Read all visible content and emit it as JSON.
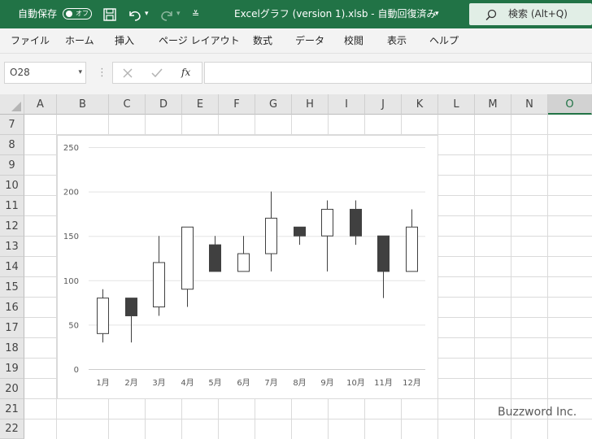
{
  "titlebar": {
    "autosave_label": "自動保存",
    "autosave_state": "オフ",
    "file_title": "Excelグラフ (version 1).xlsb - 自動回復済み",
    "search_label": "検索 (Alt+Q)"
  },
  "menu": [
    "ファイル",
    "ホーム",
    "挿入",
    "ページ レイアウト",
    "数式",
    "データ",
    "校閲",
    "表示",
    "ヘルプ"
  ],
  "namebox": {
    "value": "O28"
  },
  "formula": {
    "value": ""
  },
  "columns": [
    "A",
    "B",
    "C",
    "D",
    "E",
    "F",
    "G",
    "H",
    "I",
    "J",
    "K",
    "L",
    "M",
    "N",
    "O"
  ],
  "rows": [
    "7",
    "8",
    "9",
    "10",
    "11",
    "12",
    "13",
    "14",
    "15",
    "16",
    "17",
    "18",
    "19",
    "20",
    "21",
    "22"
  ],
  "selected_column": "O",
  "chart_data": {
    "type": "candlestick",
    "categories": [
      "1月",
      "2月",
      "3月",
      "4月",
      "5月",
      "6月",
      "7月",
      "8月",
      "9月",
      "10月",
      "11月",
      "12月"
    ],
    "open": [
      40,
      80,
      70,
      90,
      140,
      110,
      130,
      160,
      150,
      180,
      150,
      110
    ],
    "high": [
      90,
      80,
      150,
      160,
      150,
      150,
      200,
      160,
      190,
      190,
      150,
      180
    ],
    "low": [
      30,
      30,
      60,
      70,
      110,
      110,
      110,
      140,
      110,
      140,
      80,
      110
    ],
    "close": [
      80,
      60,
      120,
      160,
      110,
      130,
      170,
      150,
      180,
      150,
      110,
      160
    ],
    "ylim": [
      0,
      250
    ],
    "yticks": [
      0,
      50,
      100,
      150,
      200,
      250
    ],
    "grid": true,
    "up_color": "#ffffff",
    "down_color": "#404040"
  },
  "watermark": "Buzzword Inc.",
  "colors": {
    "brand": "#217346"
  }
}
